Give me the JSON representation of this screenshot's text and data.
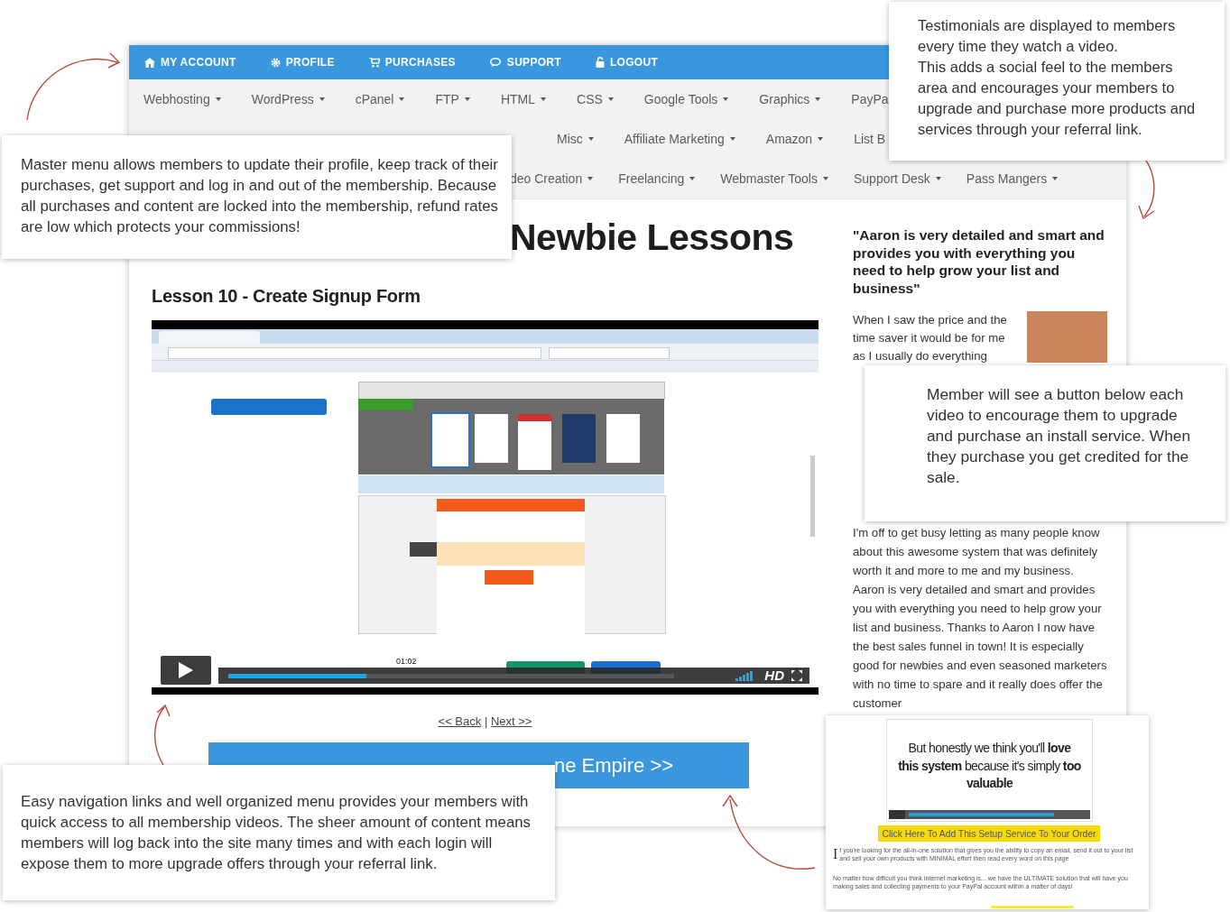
{
  "top_menu": [
    {
      "label": "MY ACCOUNT"
    },
    {
      "label": "PROFILE"
    },
    {
      "label": "PURCHASES"
    },
    {
      "label": "SUPPORT"
    },
    {
      "label": "LOGOUT"
    }
  ],
  "category_menu": {
    "rows": [
      [
        {
          "label": "Webhosting",
          "caret": true
        },
        {
          "label": "WordPress",
          "caret": true
        },
        {
          "label": "cPanel",
          "caret": true
        },
        {
          "label": "FTP",
          "caret": true
        },
        {
          "label": "HTML",
          "caret": true
        },
        {
          "label": "CSS",
          "caret": true
        },
        {
          "label": "Google Tools",
          "caret": true
        },
        {
          "label": "Graphics",
          "caret": true
        },
        {
          "label": "PayPa",
          "caret": false
        }
      ],
      [
        {
          "label": "Misc",
          "caret": true
        },
        {
          "label": "Affiliate Marketing",
          "caret": true
        },
        {
          "label": "Amazon",
          "caret": true
        },
        {
          "label": "List B",
          "caret": false
        }
      ],
      [
        {
          "label": "deo Creation",
          "caret": true
        },
        {
          "label": "Freelancing",
          "caret": true
        },
        {
          "label": "Webmaster Tools",
          "caret": true
        },
        {
          "label": "Support Desk",
          "caret": true
        },
        {
          "label": "Pass Mangers",
          "caret": true
        }
      ]
    ]
  },
  "lesson": {
    "page_title": "Newbie Lessons",
    "title": "Lesson 10 - Create Signup Form",
    "video": {
      "time": "01:02",
      "level": 0.31,
      "quality": "HD"
    },
    "pager": {
      "back": "<< Back",
      "separator": "|",
      "next": "Next >>"
    },
    "cta": "ne Empire >>"
  },
  "testimonial": {
    "quote": "\"Aaron is very detailed and smart and provides you with everything you need to help grow your list and business\"",
    "intro": "When I saw the price and the time saver it would be for me as I usually do everything",
    "body": "I'm off to get busy letting as many people know about this awesome system that was definitely worth it and more to me and my business. Aaron is very detailed and smart and provides you with everything you need to help grow your list and business. Thanks to Aaron I now have the best sales funnel in town! It is especially good for newbies and even seasoned marketers with no time to spare and it really does offer the customer"
  },
  "callouts": [
    {
      "paragraphs": [
        "Testimonials are displayed to members every time they watch a video.",
        "This adds a social feel to the members area and encourages your members to upgrade and purchase more products and services through your referral link."
      ]
    },
    {
      "paragraphs": [
        "Master menu allows members to update their profile, keep track of their purchases, get support and log in and out of the membership. Because all purchases and content are locked into the membership, refund rates are low which protects your commissions!"
      ]
    },
    {
      "paragraphs": [
        "Member will see a button below each video to encourage them to upgrade and purchase an install service. When they purchase you get credited for the sale."
      ]
    },
    {
      "paragraphs": [
        "Easy navigation links and well organized menu provides your members with quick access to all membership videos. The sheer amount of content means members will log back into the site many times and with each login will expose them to more upgrade offers through your referral link."
      ]
    }
  ],
  "sales_inset": {
    "video_text": "But honestly we think you'll **love this system** because it's simply **too valuable**",
    "button": "Click Here To Add This Setup Service To Your Order",
    "drop_cap": "I",
    "paragraph_1": "f you're looking for the all-in-one solution that gives you the ability to copy an email, send it out to your list and sell your own products with MINIMAL effort then read every word on this page",
    "paragraph_2": "No matter how difficult you think internet marketing is... we have the ULTIMATE solution that will have you making sales and collecting payments to your PayPal account within a matter of days!"
  }
}
